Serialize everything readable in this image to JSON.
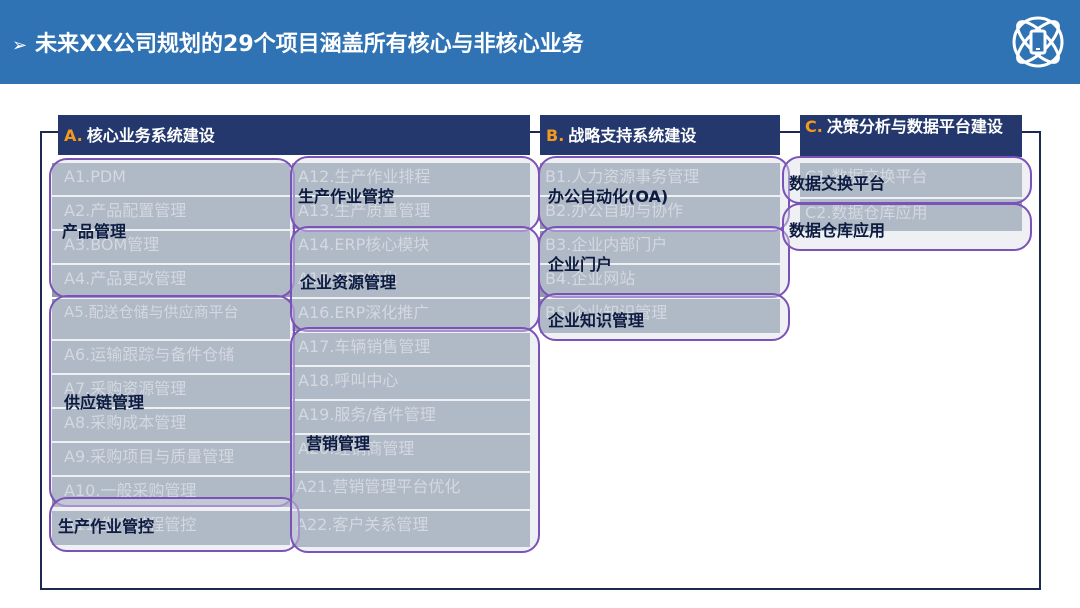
{
  "header": {
    "arrow": "➢",
    "title": "未来XX公司规划的29个项目涵盖所有核心与非核心业务"
  },
  "icon": {
    "name": "atom-device-icon",
    "color": "#ffffff"
  },
  "colors": {
    "banner": "#2f73b5",
    "section_header": "#24386e",
    "letter": "#f39a1c",
    "cell": "#8f9bab",
    "group_border": "#7b52b8"
  },
  "sections": {
    "a": {
      "letter": "A.",
      "title": "核心业务系统建设"
    },
    "b": {
      "letter": "B.",
      "title": "战略支持系统建设"
    },
    "c": {
      "letter": "C.",
      "title": "决策分析与数据平台建设"
    }
  },
  "items": {
    "a1": "A1.PDM",
    "a2": "A2.产品配置管理",
    "a3": "A3.BOM管理",
    "a4": "A4.产品更改管理",
    "a5": "A5.配送仓储与供应商平台",
    "a6": "A6.运输跟踪与备件仓储",
    "a7": "A7.采购资源管理",
    "a8": "A8.采购成本管理",
    "a9": "A9.采购项目与质量管理",
    "a10": "A10.一般采购管理",
    "a11": "A11.生产过程管控",
    "a12": "A12.生产作业排程",
    "a13": "A13.生产质量管理",
    "a14": "A14.ERP核心模块",
    "a15": "A15.ERP优化",
    "a16": "A16.ERP深化推广",
    "a17": "A17.车辆销售管理",
    "a18": "A18.呼叫中心",
    "a19": "A19.服务/备件管理",
    "a20": "A20.经销商管理",
    "a21": "A21.营销管理平台优化",
    "a22": "A22.客户关系管理",
    "b1": "B1.人力资源事务管理",
    "b2": "B2.办公自助与协作",
    "b3": "B3.企业内部门户",
    "b4": "B4.企业网站",
    "b5": "B5.企业知识管理",
    "c1": "C1.数据交换平台",
    "c2": "C2.数据仓库应用"
  },
  "groups": {
    "product": "产品管理",
    "supply": "供应链管理",
    "production_left": "生产作业管控",
    "production_top": "生产作业管控",
    "erp": "企业资源管理",
    "marketing": "营销管理",
    "oa": "办公自动化(OA)",
    "portal": "企业门户",
    "knowledge": "企业知识管理",
    "exchange": "数据交换平台",
    "warehouse": "数据仓库应用"
  }
}
